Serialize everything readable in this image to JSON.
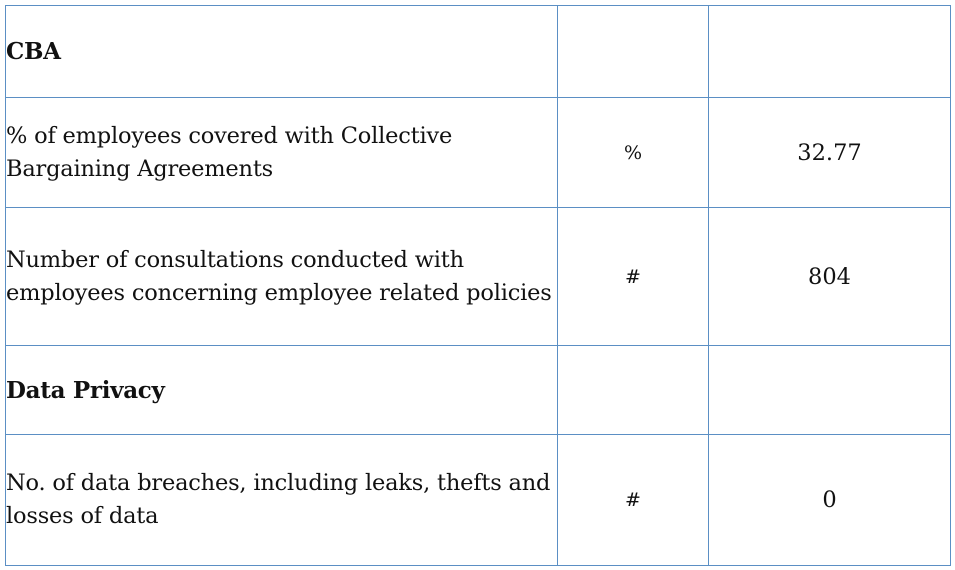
{
  "sections": [
    {
      "title": "CBA",
      "rows": [
        {
          "label": "% of employees covered with Collective Bargaining Agreements",
          "unit": "%",
          "value": "32.77"
        },
        {
          "label": "Number of consultations conducted with employees concerning employee related policies",
          "unit": "#",
          "value": "804"
        }
      ]
    },
    {
      "title": "Data Privacy",
      "rows": [
        {
          "label": "No. of data breaches, including leaks, thefts and losses of data",
          "unit": "#",
          "value": "0"
        }
      ]
    }
  ]
}
